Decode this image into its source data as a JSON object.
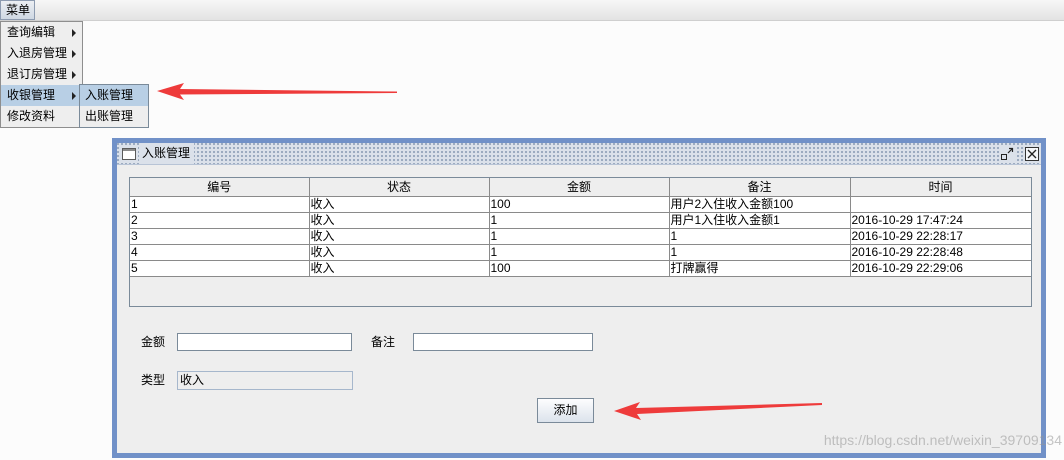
{
  "menubar": {
    "menu_label": "菜单"
  },
  "menu": {
    "items": [
      {
        "label": "查询编辑",
        "has_submenu": true,
        "highlighted": false
      },
      {
        "label": "入退房管理",
        "has_submenu": true,
        "highlighted": false
      },
      {
        "label": "退订房管理",
        "has_submenu": true,
        "highlighted": false
      },
      {
        "label": "收银管理",
        "has_submenu": true,
        "highlighted": true
      },
      {
        "label": "修改资料",
        "has_submenu": false,
        "highlighted": false
      }
    ]
  },
  "submenu": {
    "items": [
      {
        "label": "入账管理",
        "highlighted": true
      },
      {
        "label": "出账管理",
        "highlighted": false
      }
    ]
  },
  "frame": {
    "title": "入账管理"
  },
  "table": {
    "columns": [
      "编号",
      "状态",
      "金额",
      "备注",
      "时间"
    ],
    "rows": [
      [
        "1",
        "收入",
        "100",
        "用户2入住收入金额100",
        ""
      ],
      [
        "2",
        "收入",
        "1",
        "用户1入住收入金额1",
        "2016-10-29 17:47:24"
      ],
      [
        "3",
        "收入",
        "1",
        "1",
        "2016-10-29 22:28:17"
      ],
      [
        "4",
        "收入",
        "1",
        "1",
        "2016-10-29 22:28:48"
      ],
      [
        "5",
        "收入",
        "100",
        "打牌赢得",
        "2016-10-29 22:29:06"
      ]
    ]
  },
  "form": {
    "amount_label": "金额",
    "amount_value": "",
    "note_label": "备注",
    "note_value": "",
    "type_label": "类型",
    "type_value": "收入",
    "add_button": "添加"
  },
  "watermark": "https://blog.csdn.net/weixin_39709134",
  "icons": {
    "submenu_arrow": "chevron-right-icon",
    "frame_icon": "window-icon",
    "iconify": "iconify-icon",
    "close": "close-icon"
  },
  "colors": {
    "selection": "#b8cfe5",
    "frame_border": "#7191c8",
    "panel_background": "#eeeeee",
    "annotation_arrow": "#ee3b3b"
  }
}
